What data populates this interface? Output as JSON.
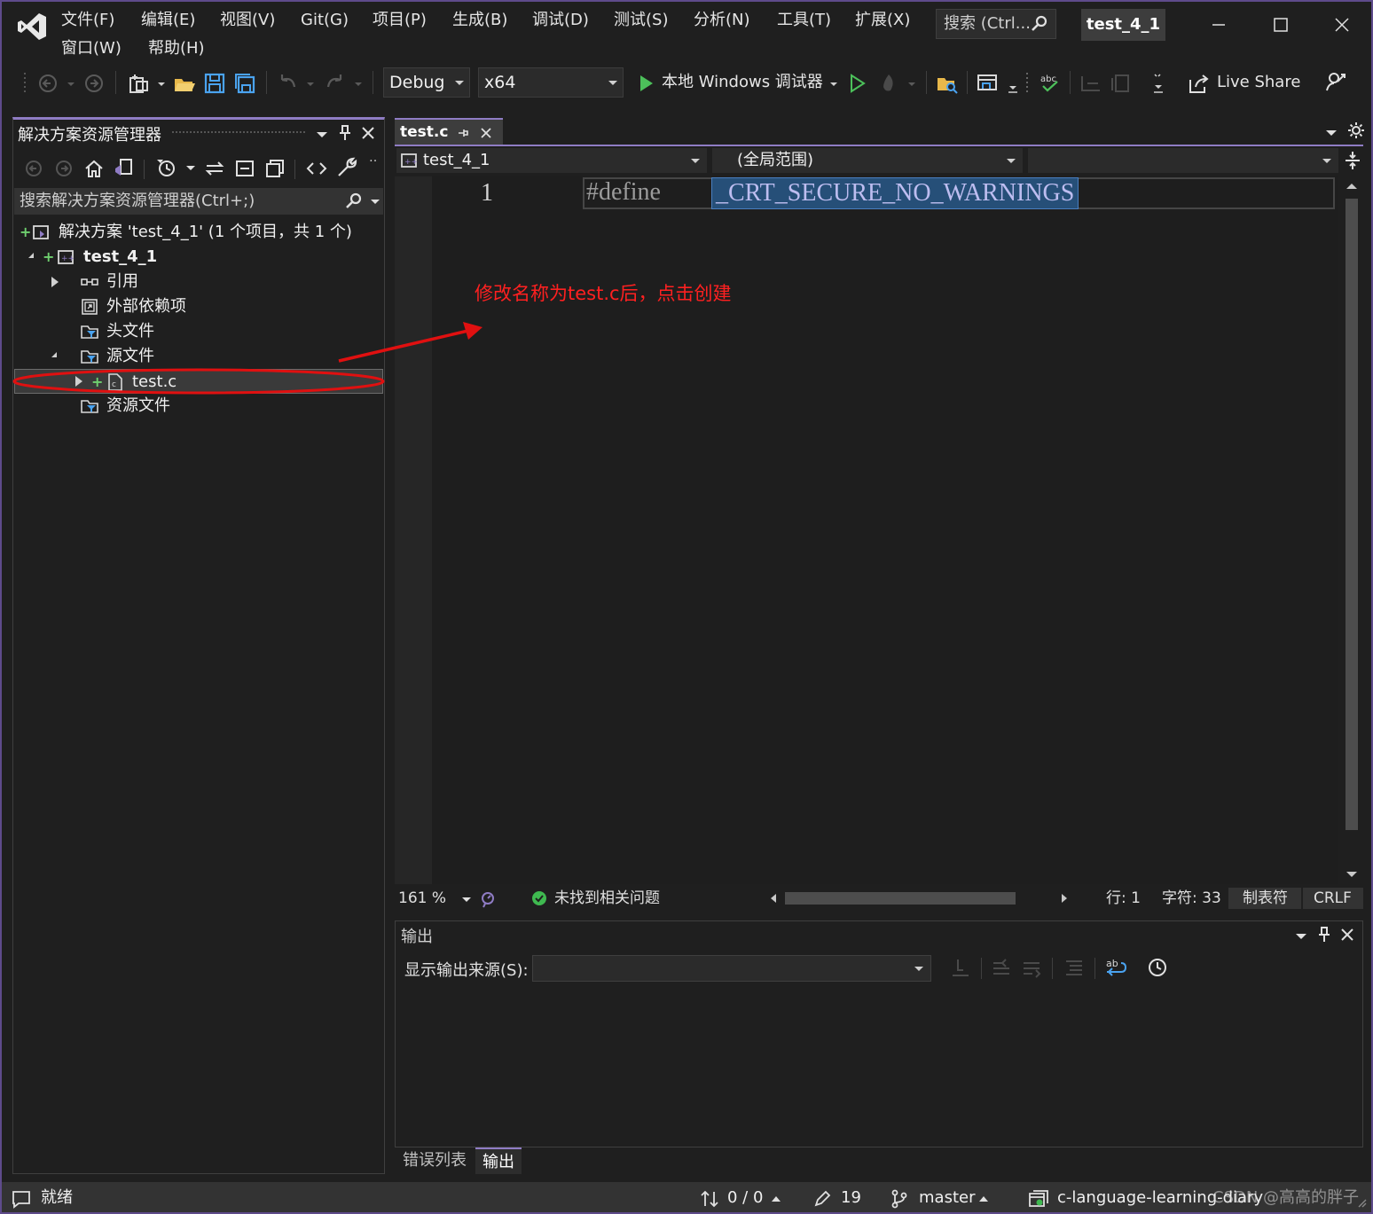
{
  "menu": {
    "row1": [
      "文件(F)",
      "编辑(E)",
      "视图(V)",
      "Git(G)",
      "项目(P)",
      "生成(B)",
      "调试(D)",
      "测试(S)",
      "分析(N)",
      "工具(T)",
      "扩展(X)"
    ],
    "row2": [
      "窗口(W)",
      "帮助(H)"
    ],
    "search_placeholder": "搜索 (Ctrl...",
    "project_title": "test_4_1"
  },
  "toolbar": {
    "config": "Debug",
    "platform": "x64",
    "run_label": "本地 Windows 调试器",
    "live_share": "Live Share"
  },
  "solution_explorer": {
    "title": "解决方案资源管理器",
    "search_placeholder": "搜索解决方案资源管理器(Ctrl+;)",
    "tree": {
      "solution": "解决方案 'test_4_1' (1 个项目，共 1 个)",
      "project": "test_4_1",
      "references": "引用",
      "external_deps": "外部依赖项",
      "header_files": "头文件",
      "source_files": "源文件",
      "file": "test.c",
      "resource_files": "资源文件"
    }
  },
  "editor": {
    "tab_label": "test.c",
    "nav_project": "test_4_1",
    "nav_scope": "(全局范围)",
    "line_number": "1",
    "code_keyword": "#define",
    "code_macro": "_CRT_SECURE_NO_WARNINGS",
    "annotation": "修改名称为test.c后，点击创建",
    "zoom": "161 %",
    "issues": "未找到相关问题",
    "line": "行: 1",
    "char": "字符: 33",
    "tabs": "制表符",
    "eol": "CRLF"
  },
  "output": {
    "title": "输出",
    "source_label": "显示输出来源(S):",
    "tabs": [
      "错误列表",
      "输出"
    ]
  },
  "statusbar": {
    "ready": "就绪",
    "sync": "0 / 0",
    "changes": "19",
    "branch": "master",
    "repo": "c-language-learning-diary",
    "watermark": "CSDN @高高的胖子"
  },
  "colors": {
    "accent": "#8f7cc4",
    "annotation": "#ff2020",
    "selection": "#264f78"
  }
}
